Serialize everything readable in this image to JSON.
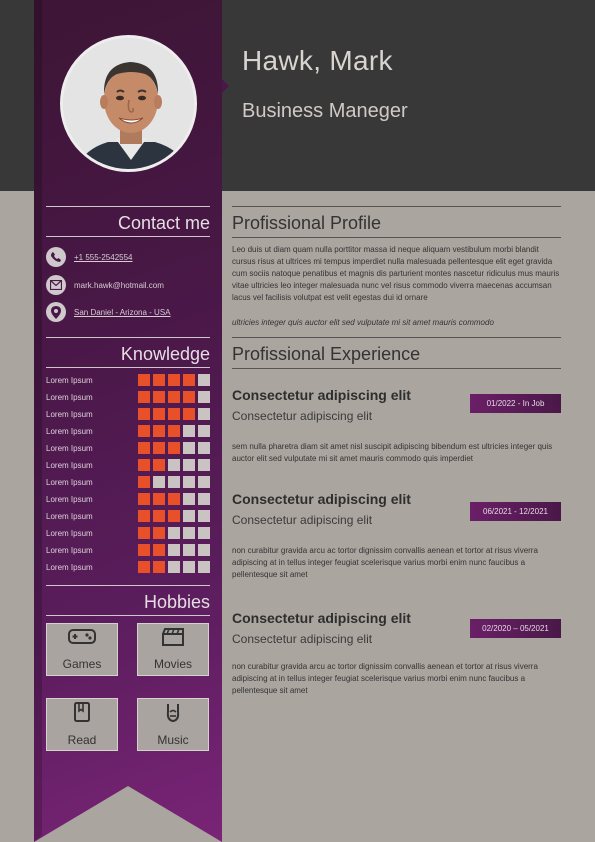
{
  "profile": {
    "name": "Hawk, Mark",
    "job_title": "Business Maneger"
  },
  "contact": {
    "heading": "Contact me",
    "phone": "+1 555-2542554",
    "email": "mark.hawk@hotmail.com",
    "location": "San Daniel - Arizona - USA"
  },
  "knowledge": {
    "heading": "Knowledge",
    "skills": [
      {
        "label": "Lorem Ipsum",
        "level": 4
      },
      {
        "label": "Lorem Ipsum",
        "level": 4
      },
      {
        "label": "Lorem Ipsum",
        "level": 4
      },
      {
        "label": "Lorem Ipsum",
        "level": 3
      },
      {
        "label": "Lorem Ipsum",
        "level": 3
      },
      {
        "label": "Lorem Ipsum",
        "level": 2
      },
      {
        "label": "Lorem Ipsum",
        "level": 1
      },
      {
        "label": "Lorem Ipsum",
        "level": 3
      },
      {
        "label": "Lorem Ipsum",
        "level": 3
      },
      {
        "label": "Lorem Ipsum",
        "level": 2
      },
      {
        "label": "Lorem Ipsum",
        "level": 2
      },
      {
        "label": "Lorem Ipsum",
        "level": 2
      }
    ],
    "max_level": 5
  },
  "hobbies": {
    "heading": "Hobbies",
    "items": [
      {
        "label": "Games",
        "icon": "gamepad-icon"
      },
      {
        "label": "Movies",
        "icon": "clapperboard-icon"
      },
      {
        "label": "Read",
        "icon": "book-icon"
      },
      {
        "label": "Music",
        "icon": "rock-hand-icon"
      }
    ]
  },
  "professional_profile": {
    "heading": "Profissional Profile",
    "text": "Leo duis ut diam quam nulla porttitor massa id neque aliquam vestibulum morbi blandit cursus risus at ultrices mi tempus imperdiet nulla malesuada pellentesque elit eget gravida cum sociis natoque penatibus et magnis dis parturient montes nascetur ridiculus mus mauris vitae ultricies leo integer malesuada nunc vel risus commodo viverra maecenas accumsan lacus vel facilisis volutpat est velit egestas dui id ornare",
    "italic_text": "ultricies integer quis auctor elit sed vulputate mi sit amet mauris commodo"
  },
  "experience": {
    "heading": "Profissional Experience",
    "jobs": [
      {
        "title": "Consectetur adipiscing elit",
        "subtitle": "Consectetur adipiscing elit",
        "dates": "01/2022 - In Job",
        "description": "sem nulla pharetra diam sit amet nisl suscipit adipiscing bibendum est ultricies integer quis auctor elit sed vulputate mi sit amet mauris commodo quis imperdiet"
      },
      {
        "title": "Consectetur adipiscing elit",
        "subtitle": "Consectetur adipiscing elit",
        "dates": "06/2021 - 12/2021",
        "description": "non curabitur gravida arcu ac tortor dignissim convallis aenean et tortor at risus viverra adipiscing at in tellus integer feugiat scelerisque varius morbi enim nunc faucibus a pellentesque sit amet"
      },
      {
        "title": "Consectetur adipiscing elit",
        "subtitle": "Consectetur adipiscing elit",
        "dates": "02/2020 – 05/2021",
        "description": "non curabitur gravida arcu ac tortor dignissim convallis aenean et tortor at risus viverra adipiscing at in tellus integer feugiat scelerisque varius morbi enim nunc faucibus a pellentesque sit amet"
      }
    ]
  },
  "colors": {
    "sidebar": "#4a1848",
    "accent": "#e8502a",
    "header": "#383838",
    "page": "#aba5a0"
  }
}
